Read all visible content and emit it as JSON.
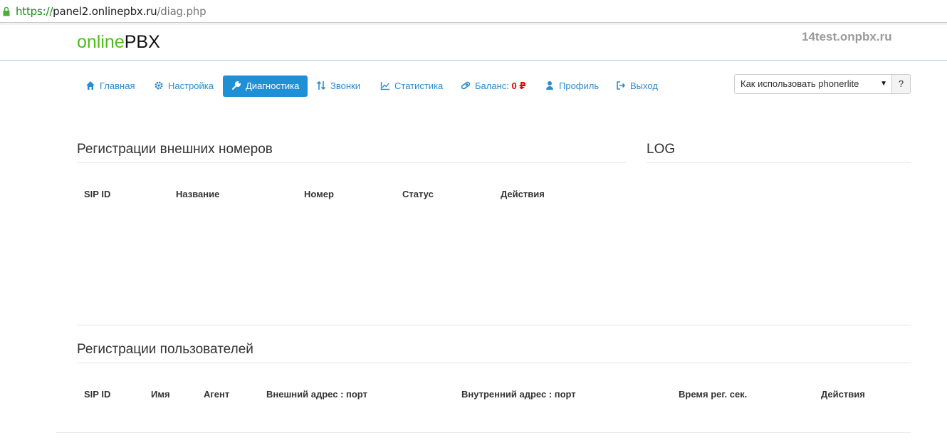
{
  "browser": {
    "url_scheme": "https://",
    "url_host": "panel2.onlinepbx.ru",
    "url_path": "/diag.php"
  },
  "header": {
    "logo_part1": "online",
    "logo_part2": "PBX",
    "domain": "14test.onpbx.ru"
  },
  "nav": {
    "items": [
      {
        "label": "Главная",
        "icon": "home-icon"
      },
      {
        "label": "Настройка",
        "icon": "gear-icon"
      },
      {
        "label": "Диагностика",
        "icon": "wrench-icon",
        "active": true
      },
      {
        "label": "Звонки",
        "icon": "arrows-updown-icon"
      },
      {
        "label": "Статистика",
        "icon": "chart-icon"
      },
      {
        "label": "Баланс:",
        "icon": "pill-icon",
        "value": "0",
        "currency": "₽"
      },
      {
        "label": "Профиль",
        "icon": "user-icon"
      },
      {
        "label": "Выход",
        "icon": "logout-icon"
      }
    ],
    "help_select": "Как использовать phonerlite",
    "help_button": "?"
  },
  "external": {
    "title": "Регистрации внешних номеров",
    "columns": [
      "SIP ID",
      "Название",
      "Номер",
      "Статус",
      "Действия"
    ],
    "rows": []
  },
  "log": {
    "title": "LOG"
  },
  "users": {
    "title": "Регистрации пользователей",
    "columns": [
      "SIP ID",
      "Имя",
      "Агент",
      "Внешний адрес : порт",
      "Внутренний адрес : порт",
      "Время рег. сек.",
      "Действия"
    ],
    "rows": []
  },
  "colors": {
    "accent": "#1f8fd6",
    "link": "#2a8ccf",
    "logo_green": "#4cbc1c",
    "balance_red": "#e00000"
  }
}
